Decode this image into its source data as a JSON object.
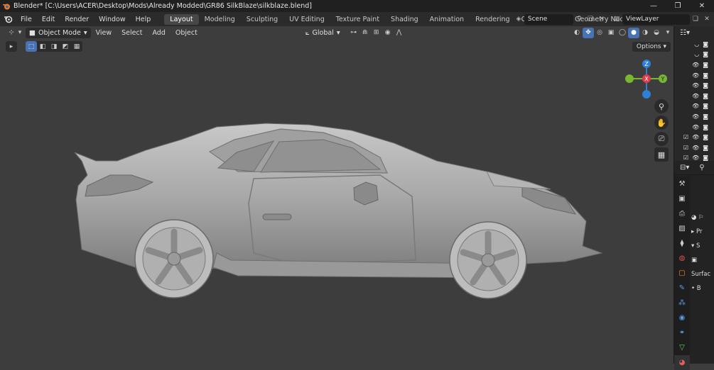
{
  "titlebar": {
    "title": "Blender* [C:\\Users\\ACER\\Desktop\\Mods\\Already Modded\\GR86 SilkBlaze\\silkblaze.blend]",
    "minimize": "—",
    "maximize": "❐",
    "close": "✕"
  },
  "menubar": {
    "items": [
      "File",
      "Edit",
      "Render",
      "Window",
      "Help"
    ],
    "workspaces": [
      "Layout",
      "Modeling",
      "Sculpting",
      "UV Editing",
      "Texture Paint",
      "Shading",
      "Animation",
      "Rendering",
      "Compositing",
      "Geometry Noc"
    ],
    "active_workspace": "Layout",
    "scene": "Scene",
    "view_layer": "ViewLayer"
  },
  "viewport": {
    "mode": "Object Mode",
    "menus": [
      "View",
      "Select",
      "Add",
      "Object"
    ],
    "transform_orientation": "Global",
    "options_label": "Options",
    "gizmo_labels": {
      "x": "X",
      "y": "Y",
      "z": "Z"
    }
  },
  "outliner": {
    "row_count": 12
  },
  "properties": {
    "labels": [
      "Pr",
      "S",
      "Surfac"
    ]
  },
  "colors": {
    "accent": "#4772b3",
    "axis_x": "#e03a4b",
    "axis_y": "#79b631",
    "axis_z": "#2e7fd6",
    "car_body": "#a4a4a4"
  }
}
